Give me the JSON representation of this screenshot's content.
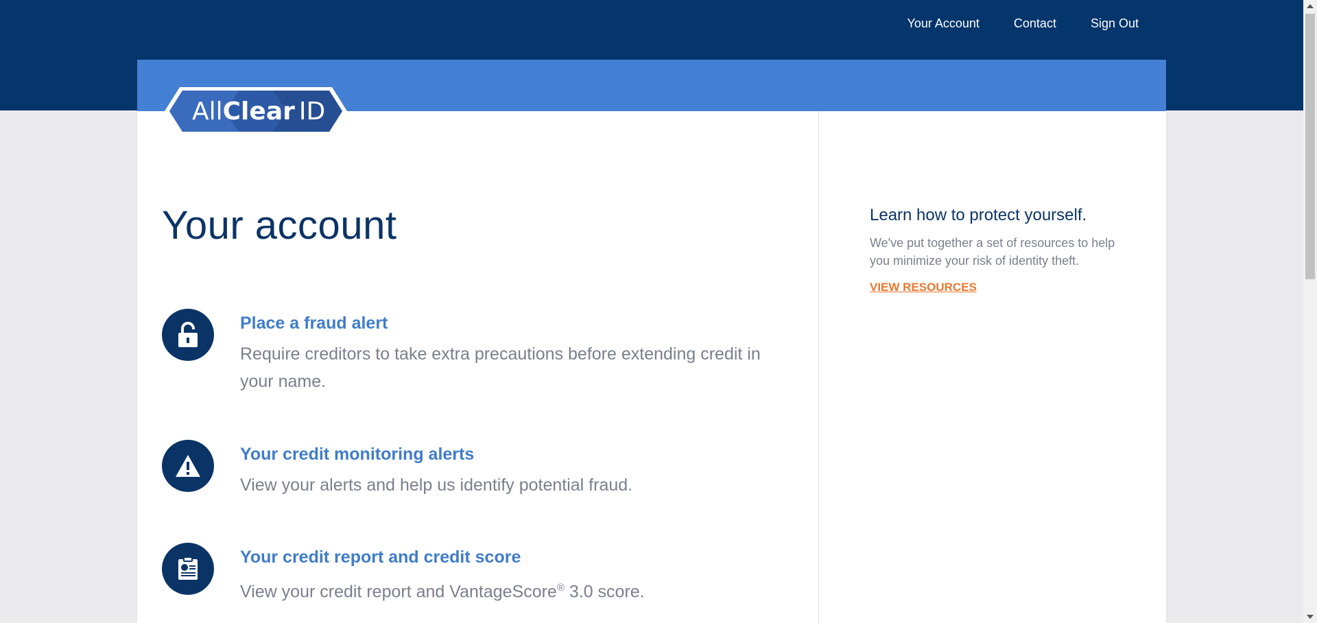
{
  "nav": {
    "your_account": "Your Account",
    "contact": "Contact",
    "sign_out": "Sign Out"
  },
  "logo": {
    "text_light": "All",
    "text_bold": "Clear",
    "text_id": "ID"
  },
  "main": {
    "title": "Your account",
    "items": [
      {
        "icon": "lock-icon",
        "title": "Place a fraud alert",
        "description": "Require creditors to take extra precautions before extending credit in your name."
      },
      {
        "icon": "warning-icon",
        "title": "Your credit monitoring alerts",
        "description": "View your alerts and help us identify potential fraud."
      },
      {
        "icon": "clipboard-report-icon",
        "title": "Your credit report and credit score",
        "description_pre": "View your credit report and VantageScore",
        "description_sup": "®",
        "description_post": " 3.0 score."
      }
    ]
  },
  "aside": {
    "title": "Learn how to protect yourself.",
    "text": "We've put together a set of resources to help you minimize your risk of identity theft.",
    "link": "VIEW RESOURCES"
  },
  "colors": {
    "topbar": "#04356b",
    "band": "#4480d3",
    "title": "#0b3466",
    "link": "#3f7ccb",
    "accent": "#e8772e"
  }
}
